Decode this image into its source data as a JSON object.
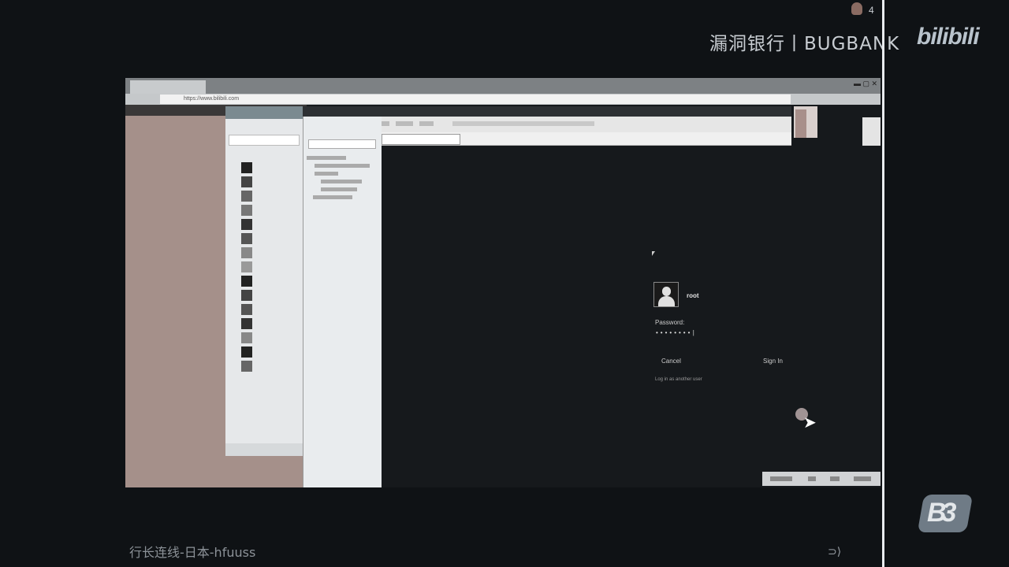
{
  "overlay": {
    "brand_text": "漏洞银行丨BUGBANK",
    "platform_logo": "bilibili",
    "counter": "4",
    "caption": "行长连线-日本-hfuuss",
    "corner_logo": "B3"
  },
  "host_browser": {
    "url": "https://www.bilibili.com"
  },
  "login": {
    "username": "root",
    "password_label": "Password:",
    "password_value": "••••••••|",
    "cancel_label": "Cancel",
    "signin_label": "Sign In",
    "not_listed_label": "Log in as another user"
  },
  "colors": {
    "background": "#0f1215",
    "host_page": "#a5908a",
    "panel": "#e6e8ea",
    "divider": "#e9ecef"
  },
  "icons": [
    "user-avatar-icon",
    "mouse-cursor-icon",
    "notification-counter-icon"
  ]
}
